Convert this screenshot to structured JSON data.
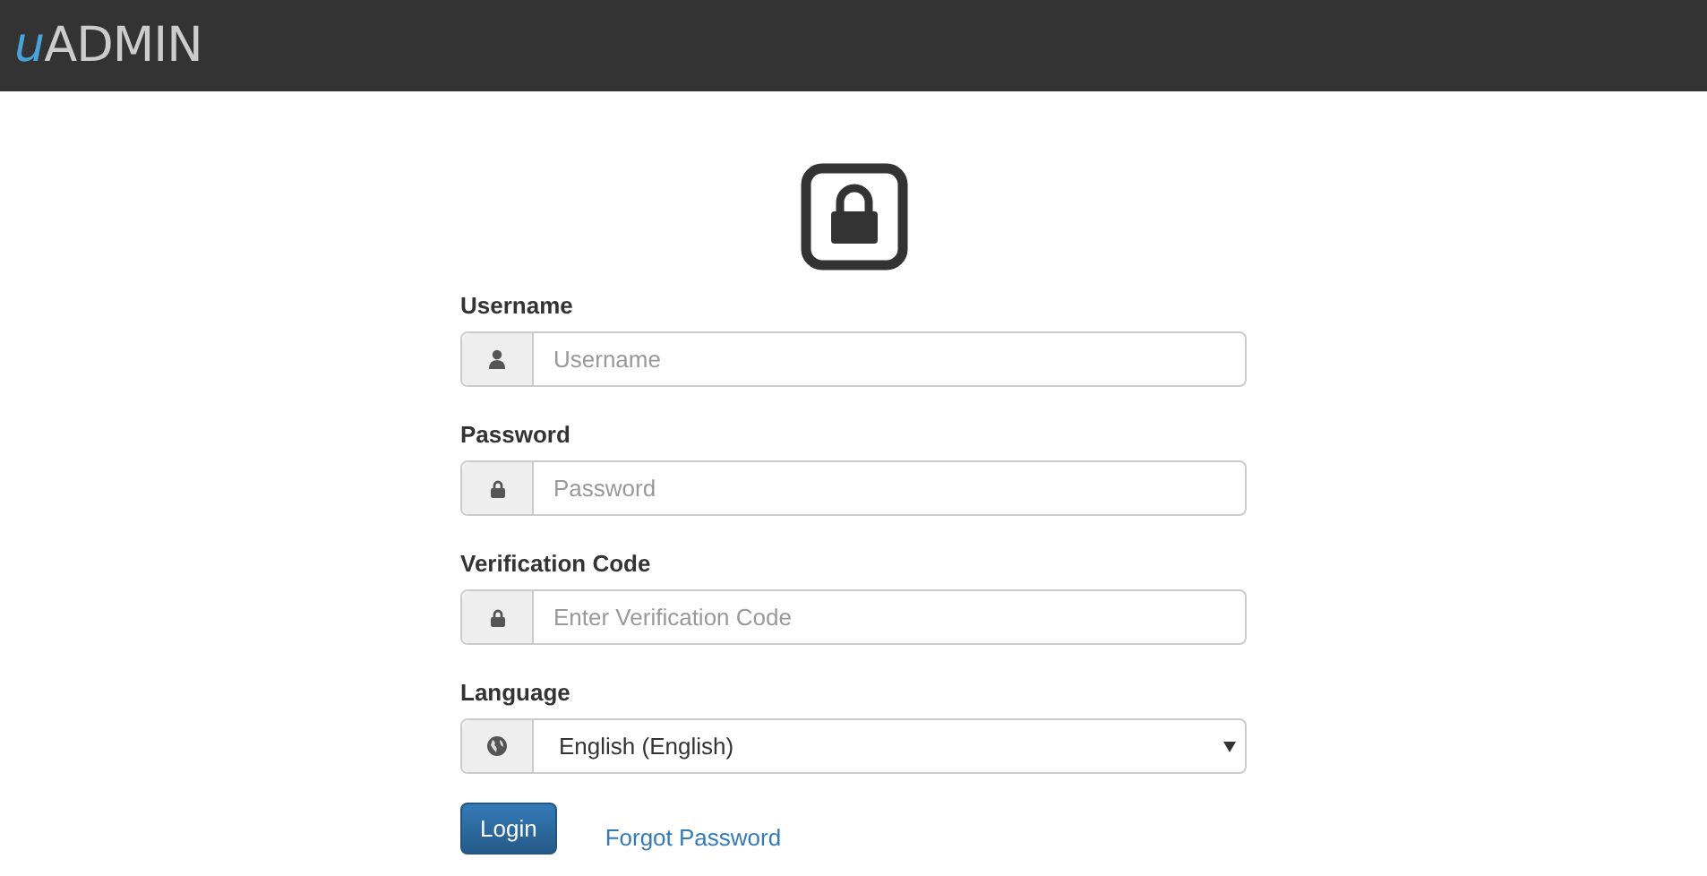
{
  "header": {
    "logo_mark": "u",
    "logo_text": "ADMIN"
  },
  "fields": [
    {
      "label": "Username",
      "kind": "input",
      "placeholder": "Username"
    },
    {
      "label": "Password",
      "kind": "input",
      "placeholder": "Password"
    },
    {
      "label": "Verification Code",
      "kind": "input",
      "placeholder": "Enter Verification Code"
    },
    {
      "label": "Language",
      "kind": "select",
      "value": "English (English)"
    }
  ],
  "login_button": "Login",
  "forgot_link": "Forgot Password"
}
